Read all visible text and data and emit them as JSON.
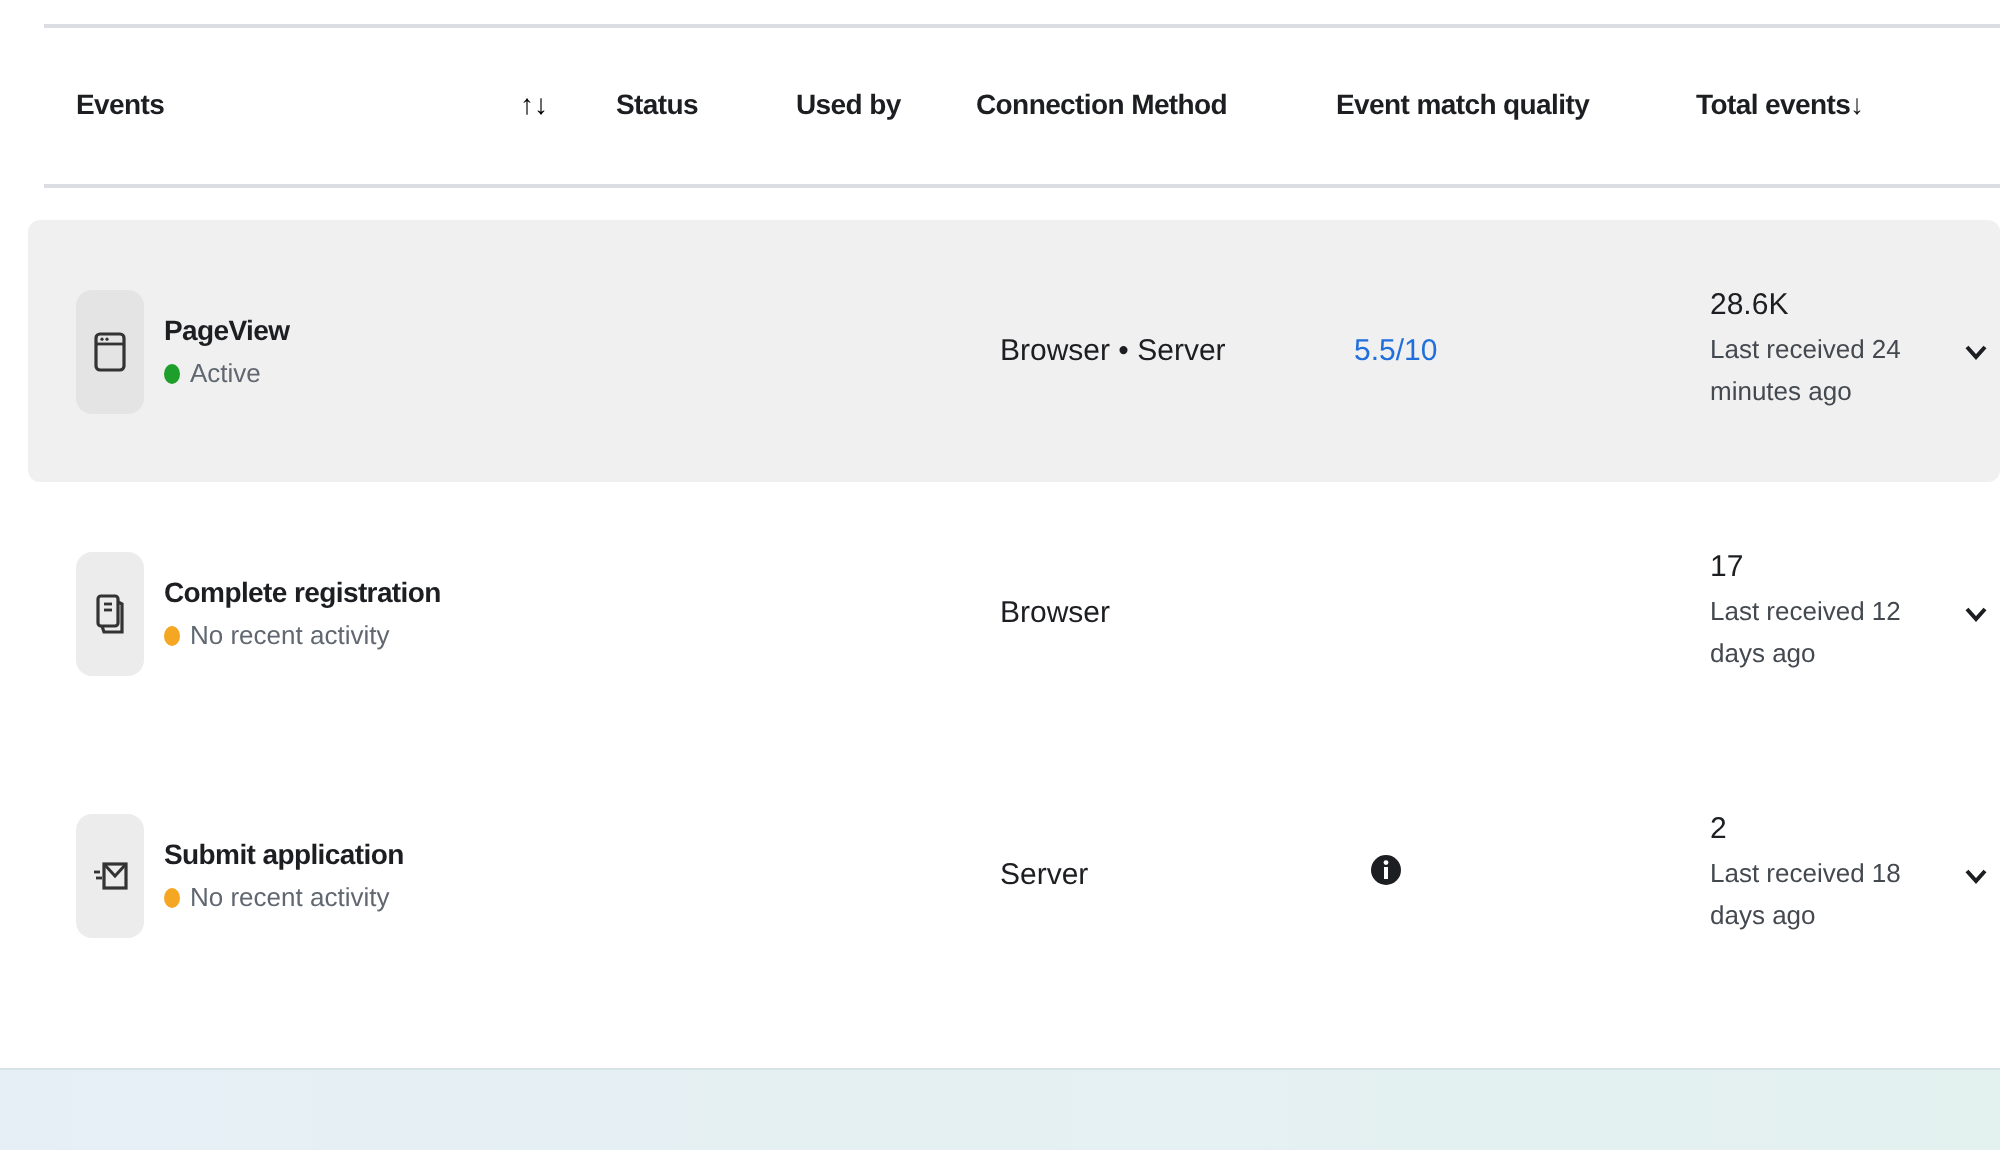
{
  "table": {
    "columns": [
      {
        "label": "Events"
      },
      {
        "label": "↑↓",
        "kind": "sort"
      },
      {
        "label": "Status"
      },
      {
        "label": "Used by"
      },
      {
        "label": "Connection Method"
      },
      {
        "label": "Event match quality"
      },
      {
        "label": "Total events↓"
      }
    ],
    "rows": [
      {
        "kind": "browser",
        "name": "PageView",
        "status": "Active",
        "color": "#1e9e2a",
        "connection": "Browser • Server",
        "match_quality": {
          "kind": "score",
          "text": "5.5/10"
        },
        "total": "28.6K",
        "last_received": "Last received 24 minutes ago",
        "highlighted": true,
        "expanded": false
      },
      {
        "kind": "document",
        "name": "Complete registration",
        "status": "No recent activity",
        "color": "#f5a623",
        "connection": "Browser",
        "total": "17",
        "last_received": "Last received 12 days ago",
        "highlighted": false,
        "expanded": false
      },
      {
        "kind": "envelope",
        "name": "Submit application",
        "status": "No recent activity",
        "color": "#f5a623",
        "connection": "Server",
        "match_quality": {
          "kind": "info"
        },
        "total": "2",
        "last_received": "Last received 18 days ago",
        "highlighted": false,
        "expanded": false
      }
    ]
  }
}
